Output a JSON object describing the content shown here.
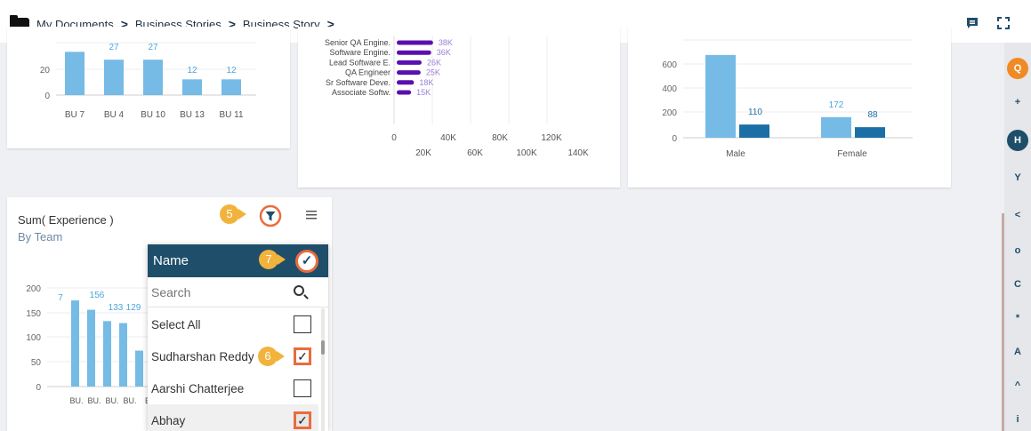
{
  "breadcrumb": {
    "items": [
      "My Documents",
      "Business Stories",
      "Business Story"
    ],
    "sep": ">"
  },
  "topbar_icons": [
    "comment-icon",
    "fullscreen-icon"
  ],
  "charts": {
    "card1": {
      "type": "bar",
      "categories": [
        "BU 7",
        "BU 4",
        "BU 10",
        "BU 13",
        "BU 11"
      ],
      "values": [
        33,
        27,
        27,
        12,
        12
      ],
      "data_labels": [
        "27",
        "27",
        "12",
        "12"
      ],
      "y_ticks": [
        "20",
        "0"
      ],
      "color": "#75bbe6"
    },
    "card2": {
      "type": "bar-horizontal",
      "categories": [
        "Senior QA Engine.",
        "Software Engine.",
        "Lead Software E.",
        "QA Engineer",
        "Sr Software Deve.",
        "Associate Softw."
      ],
      "values": [
        38000,
        36000,
        26000,
        25000,
        18000,
        15000
      ],
      "data_labels": [
        "38K",
        "36K",
        "26K",
        "25K",
        "18K",
        "15K"
      ],
      "x_ticks_row1": [
        "0",
        "40K",
        "80K",
        "120K"
      ],
      "x_ticks_row2": [
        "20K",
        "60K",
        "100K",
        "140K"
      ],
      "color": "#5a0fb0"
    },
    "card3": {
      "type": "bar-grouped",
      "categories": [
        "Male",
        "Female"
      ],
      "series": [
        {
          "values": [
            690,
            172
          ],
          "color": "#75bbe6"
        },
        {
          "values": [
            110,
            88
          ],
          "color": "#1c6fa6"
        }
      ],
      "data_labels": [
        "110",
        "172",
        "88"
      ],
      "y_ticks": [
        "600",
        "400",
        "200",
        "0"
      ]
    },
    "card4": {
      "title": "Sum( Experience )",
      "subtitle": "By Team",
      "type": "bar",
      "values": [
        175,
        156,
        133,
        129,
        73
      ],
      "data_labels": [
        "156",
        "133",
        "129"
      ],
      "data_label_fragments": [
        "7",
        "7"
      ],
      "y_ticks": [
        "200",
        "150",
        "100",
        "50",
        "0"
      ],
      "x_tick_labels": [
        "BU.",
        "BU.",
        "BU.",
        "BU.",
        "B"
      ],
      "color": "#75bbe6"
    }
  },
  "steps": {
    "s5": "5",
    "s6": "6",
    "s7": "7"
  },
  "filter": {
    "header": "Name",
    "apply_icon": "✓",
    "search_placeholder": "Search",
    "rows": [
      {
        "label": "Select All",
        "checked": false
      },
      {
        "label": "Sudharshan Reddy",
        "checked": true
      },
      {
        "label": "Aarshi Chatterjee",
        "checked": false
      },
      {
        "label": "Abhay",
        "checked": true
      }
    ],
    "check_glyph": "✓"
  },
  "sidebar": {
    "buttons": [
      {
        "icon": "search-icon",
        "glyph": "Q",
        "color": "#f08a24",
        "fill": true
      },
      {
        "icon": "plus-icon",
        "glyph": "+",
        "color": "#1f4e6a",
        "fill": false
      },
      {
        "icon": "save-icon",
        "glyph": "H",
        "color": "#1f4e6a",
        "fill": true
      },
      {
        "icon": "filter-icon",
        "glyph": "Y",
        "color": "#1f4e6a",
        "fill": false
      },
      {
        "icon": "share-icon",
        "glyph": "<",
        "color": "#1f4e6a",
        "fill": false
      },
      {
        "icon": "eye-icon",
        "glyph": "o",
        "color": "#1f4e6a",
        "fill": false
      },
      {
        "icon": "refresh-icon",
        "glyph": "C",
        "color": "#1f4e6a",
        "fill": false
      },
      {
        "icon": "settings-icon",
        "glyph": "*",
        "color": "#1f4e6a",
        "fill": false
      },
      {
        "icon": "user-icon",
        "glyph": "A",
        "color": "#1f4e6a",
        "fill": false
      },
      {
        "icon": "bell-icon",
        "glyph": "^",
        "color": "#1f4e6a",
        "fill": false
      },
      {
        "icon": "info-icon",
        "glyph": "i",
        "color": "#1f4e6a",
        "fill": false
      }
    ]
  }
}
